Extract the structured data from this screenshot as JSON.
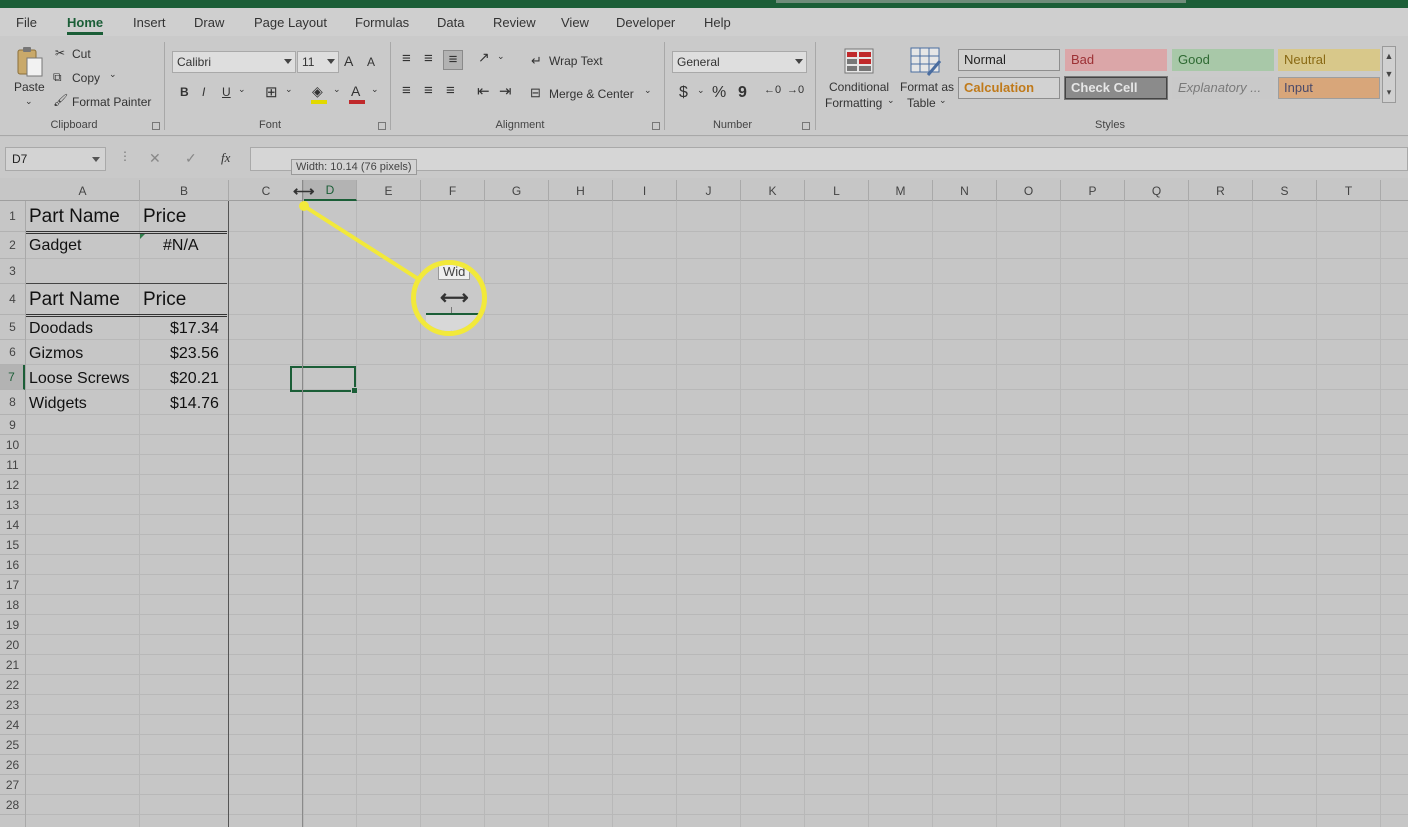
{
  "menu": {
    "tabs": [
      "File",
      "Home",
      "Insert",
      "Draw",
      "Page Layout",
      "Formulas",
      "Data",
      "Review",
      "View",
      "Developer",
      "Help"
    ],
    "active": "Home"
  },
  "ribbon": {
    "clipboard": {
      "paste": "Paste",
      "cut": "Cut",
      "copy": "Copy",
      "format_painter": "Format Painter",
      "label": "Clipboard"
    },
    "font": {
      "name": "Calibri",
      "size": "11",
      "bold": "B",
      "italic": "I",
      "underline": "U",
      "grow": "A",
      "shrink": "A",
      "font_color": "A",
      "label": "Font"
    },
    "alignment": {
      "wrap_text": "Wrap Text",
      "merge_center": "Merge & Center",
      "label": "Alignment"
    },
    "number": {
      "format": "General",
      "currency": "$",
      "percent": "%",
      "comma": "9",
      "label": "Number"
    },
    "styles": {
      "conditional_formatting_1": "Conditional",
      "conditional_formatting_2": "Formatting",
      "format_as_table_1": "Format as",
      "format_as_table_2": "Table",
      "cells": [
        {
          "name": "Normal",
          "bg": "#d2d2d2",
          "fg": "#222222",
          "border": "#8e8e8e"
        },
        {
          "name": "Bad",
          "bg": "#dba6a8",
          "fg": "#9c3034",
          "border": "#dba6a8"
        },
        {
          "name": "Good",
          "bg": "#a8c8a8",
          "fg": "#2f6a33",
          "border": "#a8c8a8"
        },
        {
          "name": "Neutral",
          "bg": "#d8c88a",
          "fg": "#8a6a14",
          "border": "#d8c88a"
        },
        {
          "name": "Calculation",
          "bg": "#d2d2d2",
          "fg": "#c07a1a",
          "border": "#8e8e8e"
        },
        {
          "name": "Check Cell",
          "bg": "#8b8b8b",
          "fg": "#e6e6e6",
          "border": "#444444"
        },
        {
          "name": "Explanatory ...",
          "bg": "#c9c9c9",
          "fg": "#7a7a7a",
          "border": "#c9c9c9"
        },
        {
          "name": "Input",
          "bg": "#d8a67a",
          "fg": "#4a4a6a",
          "border": "#9e9e9e"
        }
      ],
      "label": "Styles"
    }
  },
  "formula_bar": {
    "name_box": "D7",
    "fx": "fx",
    "value": "",
    "width_tooltip": "Width: 10.14 (76 pixels)"
  },
  "grid": {
    "columns": [
      "A",
      "B",
      "C",
      "D",
      "E",
      "F",
      "G",
      "H",
      "I",
      "J",
      "K",
      "L",
      "M",
      "N",
      "O",
      "P",
      "Q",
      "R",
      "S",
      "T"
    ],
    "rows": [
      "1",
      "2",
      "3",
      "4",
      "5",
      "6",
      "7",
      "8",
      "9",
      "10",
      "11",
      "12",
      "13",
      "14",
      "15",
      "16",
      "17",
      "18",
      "19",
      "20",
      "21",
      "22",
      "23",
      "24",
      "25",
      "26",
      "27",
      "28"
    ],
    "selected_column": "D",
    "selected_row": "7",
    "active_cell": "D7"
  },
  "cells": {
    "A1": "Part Name",
    "B1": "Price",
    "A2": "Gadget",
    "B2": "#N/A",
    "A4": "Part Name",
    "B4": "Price",
    "A5": "Doodads",
    "B5": "$17.34",
    "A6": "Gizmos",
    "B6": "$23.56",
    "A7": "Loose Screws",
    "B7": "$20.21",
    "A8": "Widgets",
    "B8": "$14.76"
  },
  "callout": {
    "magnified_text": "Wid",
    "highlight_color": "#f2e93a"
  }
}
